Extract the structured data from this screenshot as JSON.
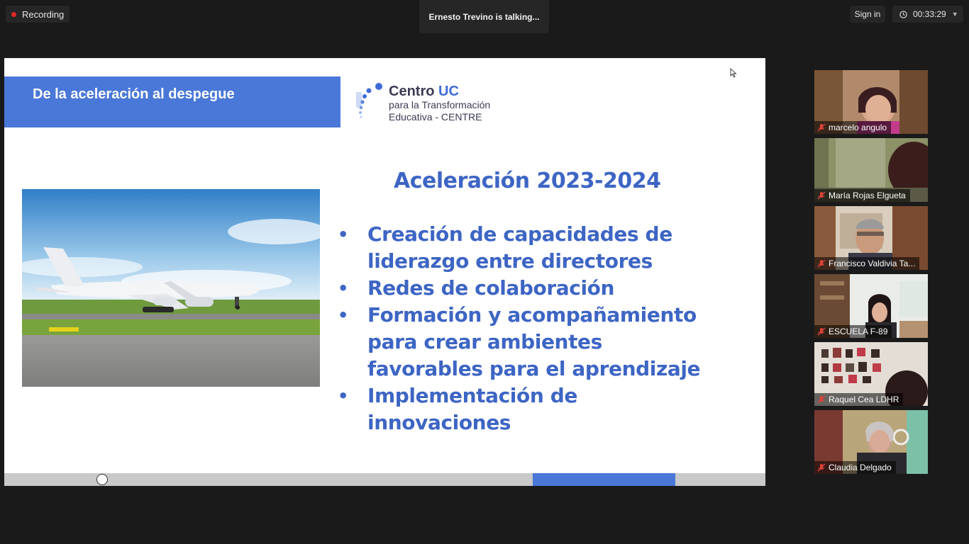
{
  "topbar": {
    "recording_label": "Recording",
    "talking_label": "Ernesto Trevino is talking...",
    "signin_label": "Sign in",
    "timer_value": "00:33:29"
  },
  "slide": {
    "title": "De la aceleración al despegue",
    "logo": {
      "centro": "Centro ",
      "uc": "UC",
      "line1": "para la Transformación",
      "line2": "Educativa - CENTRE"
    },
    "heading": "Aceleración 2023-2024",
    "bullets": [
      {
        "line1": "Creación  de capacidades de",
        "line2": "liderazgo entre directores",
        "line3": ""
      },
      {
        "line1": "Redes de colaboración",
        "line2": "",
        "line3": ""
      },
      {
        "line1": "Formación y acompañamiento",
        "line2": "para crear ambientes",
        "line3": "favorables para el aprendizaje"
      },
      {
        "line1": "Implementación de",
        "line2": "innovaciones",
        "line3": ""
      }
    ],
    "bullet_symbol": "•"
  },
  "participants": [
    {
      "name": "marcelo angulo",
      "muted": true
    },
    {
      "name": "María Rojas Elgueta",
      "muted": true
    },
    {
      "name": "Francisco Valdivia Ta...",
      "muted": true
    },
    {
      "name": "ESCUELA F-89",
      "muted": true
    },
    {
      "name": "Raquel Cea LDHR",
      "muted": true
    },
    {
      "name": "Claudia Delgado",
      "muted": true
    }
  ],
  "colors": {
    "accent": "#4a78d8",
    "slide_text": "#3d65c4",
    "mute_icon": "#e0413a"
  }
}
